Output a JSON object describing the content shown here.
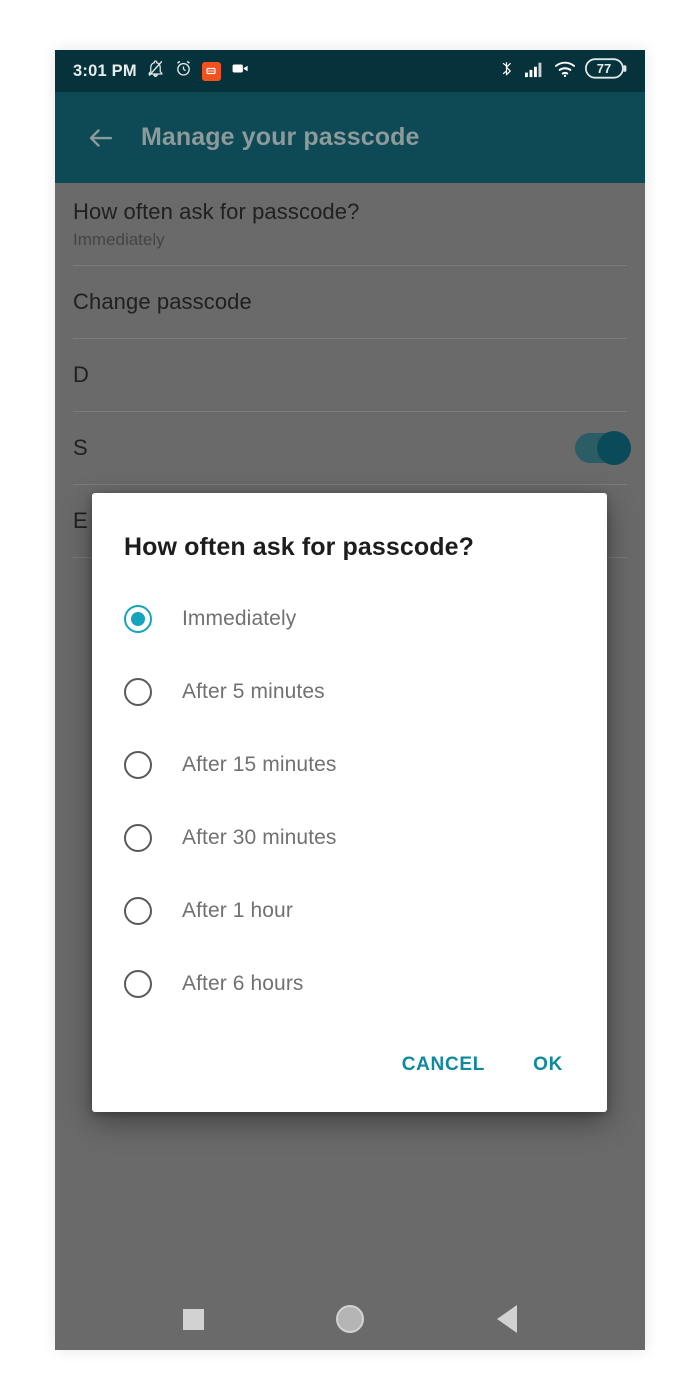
{
  "status_bar": {
    "clock": "3:01 PM",
    "left_icons": [
      {
        "name": "notifications-muted-icon",
        "glyph": "bell-slash"
      },
      {
        "name": "alarm-clock-icon",
        "glyph": "alarm"
      },
      {
        "name": "app-badge-icon",
        "glyph": "orange-app"
      },
      {
        "name": "video-camera-icon",
        "glyph": "camcorder"
      }
    ],
    "right_icons": [
      {
        "name": "bluetooth-icon",
        "glyph": "bluetooth"
      },
      {
        "name": "cellular-signal-icon",
        "glyph": "signal-bars"
      },
      {
        "name": "wifi-icon",
        "glyph": "wifi"
      }
    ],
    "battery_level": "77"
  },
  "app_bar": {
    "back_label": "Back",
    "title": "Manage your passcode"
  },
  "settings_list": [
    {
      "title": "How often ask for passcode?",
      "subtitle": "Immediately",
      "toggle": false
    },
    {
      "title": "Change passcode",
      "subtitle": "",
      "toggle": false
    },
    {
      "title": "D",
      "subtitle": "",
      "toggle": false
    },
    {
      "title": "S",
      "subtitle": "",
      "toggle": true
    },
    {
      "title": "E",
      "subtitle": "",
      "toggle": false
    }
  ],
  "dialog": {
    "title": "How often ask for passcode?",
    "options": [
      {
        "label": "Immediately",
        "selected": true
      },
      {
        "label": "After 5 minutes",
        "selected": false
      },
      {
        "label": "After 15 minutes",
        "selected": false
      },
      {
        "label": "After 30 minutes",
        "selected": false
      },
      {
        "label": "After 1 hour",
        "selected": false
      },
      {
        "label": "After 6 hours",
        "selected": false
      }
    ],
    "cancel_label": "CANCEL",
    "ok_label": "OK"
  },
  "nav_bar": {
    "recents_label": "Recents",
    "home_label": "Home",
    "back_label": "Back"
  },
  "colors": {
    "status_bar_bg": "#05323b",
    "app_bar_bg": "#0d4a55",
    "scrim": "#6a6a6a",
    "accent_radio": "#15a3bd",
    "accent_button": "#10899e",
    "badge_orange": "#f1521d",
    "toggle_thumb": "#0b4a58"
  }
}
